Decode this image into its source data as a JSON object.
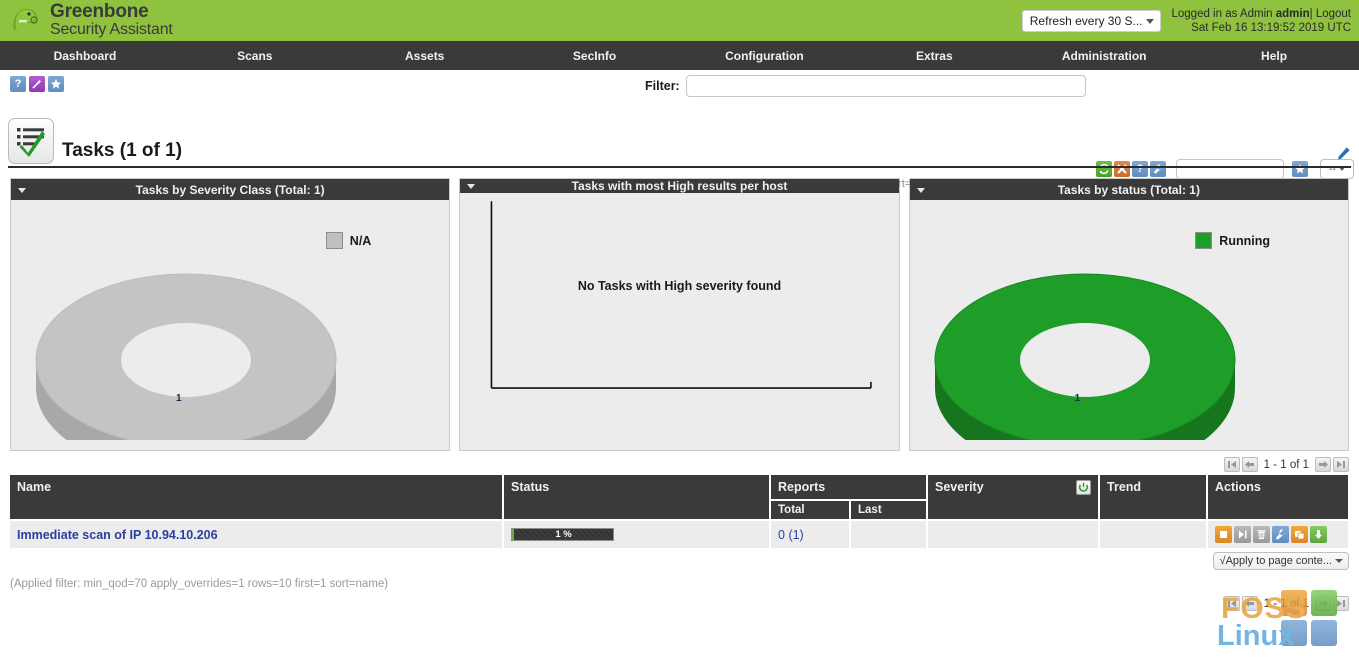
{
  "header": {
    "brand_line1": "Greenbone",
    "brand_line2": "Security Assistant",
    "refresh_select": "Refresh every 30 S...",
    "logged_in_prefix": "Logged in as",
    "role": "Admin",
    "username": "admin",
    "separator": "|",
    "logout": "Logout",
    "datetime": "Sat Feb 16 13:19:52 2019 UTC",
    "brand_bg": "#8fc23f"
  },
  "nav": {
    "items": [
      {
        "label": "Dashboard"
      },
      {
        "label": "Scans"
      },
      {
        "label": "Assets"
      },
      {
        "label": "SecInfo"
      },
      {
        "label": "Configuration"
      },
      {
        "label": "Extras"
      },
      {
        "label": "Administration"
      },
      {
        "label": "Help"
      }
    ]
  },
  "toolbar": {
    "icons": [
      {
        "name": "help-icon",
        "glyph": "?"
      },
      {
        "name": "wizard-icon",
        "glyph": "✳"
      },
      {
        "name": "favorites-star-icon",
        "glyph": "★"
      }
    ],
    "filter_label": "Filter:",
    "filter_value": "",
    "filter_placeholder": "",
    "filter_applied_text": "min_qod=70 apply_overrides=1 rows=10 first=1 sort=name",
    "action_icons": [
      {
        "name": "refresh-filter-icon",
        "glyph": "↻"
      },
      {
        "name": "reset-filter-icon",
        "glyph": "✖"
      },
      {
        "name": "filter-help-icon",
        "glyph": "?"
      },
      {
        "name": "edit-filter-icon",
        "glyph": "⚒"
      }
    ],
    "filter_name_value": "",
    "filter_name_placeholder": "",
    "save-star": "★",
    "mini_select_value": "--"
  },
  "page": {
    "title": "Tasks (1 of 1)",
    "edit_icon": "edit-dashboard-icon"
  },
  "dashboard": {
    "panels": [
      {
        "title": "Tasks by Severity Class (Total: 1)",
        "legend": [
          {
            "label": "N/A",
            "color": "#c0c0c0"
          }
        ],
        "center_value": "1"
      },
      {
        "title": "Tasks with most High results per host",
        "empty_message": "No Tasks with High severity found"
      },
      {
        "title": "Tasks by status (Total: 1)",
        "legend": [
          {
            "label": "Running",
            "color": "#1e9e29"
          }
        ],
        "center_value": "1"
      }
    ]
  },
  "chart_data": [
    {
      "type": "pie",
      "title": "Tasks by Severity Class (Total: 1)",
      "labels": [
        "N/A"
      ],
      "values": [
        1
      ],
      "colors": [
        "#c0c0c0"
      ],
      "total": 1,
      "legend_position": "top-right",
      "center_label": "1"
    },
    {
      "type": "bar",
      "title": "Tasks with most High results per host",
      "categories": [],
      "values": [],
      "xlabel": "",
      "ylabel": "",
      "grid": false,
      "annotation": "No Tasks with High severity found"
    },
    {
      "type": "pie",
      "title": "Tasks by status (Total: 1)",
      "labels": [
        "Running"
      ],
      "values": [
        1
      ],
      "colors": [
        "#1e9e29"
      ],
      "total": 1,
      "legend_position": "top-right",
      "center_label": "1"
    }
  ],
  "pager": {
    "text": "1 - 1 of 1",
    "first": "first-page",
    "prev": "previous-page",
    "next": "next-page",
    "last": "last-page"
  },
  "table": {
    "columns": {
      "name": "Name",
      "status": "Status",
      "reports": "Reports",
      "reports_total": "Total",
      "reports_last": "Last",
      "severity": "Severity",
      "trend": "Trend",
      "actions": "Actions"
    },
    "rows": [
      {
        "name": "Immediate scan of IP 10.94.10.206",
        "status_percent": "1 %",
        "reports_total": "0",
        "reports_total_paren": "(1)",
        "reports_last": "",
        "severity": "",
        "trend": "",
        "actions": [
          {
            "name": "stop-task-icon",
            "glyph": "■"
          },
          {
            "name": "resume-task-icon",
            "glyph": "▶"
          },
          {
            "name": "delete-task-icon",
            "glyph": "🗑"
          },
          {
            "name": "edit-task-icon",
            "glyph": "⚒"
          },
          {
            "name": "clone-task-icon",
            "glyph": "❐"
          },
          {
            "name": "export-task-icon",
            "glyph": "⬇"
          }
        ]
      }
    ]
  },
  "bottom": {
    "apply_select": "√Apply to page conte...",
    "applied_filter_note": "(Applied filter: min_qod=70 apply_overrides=1 rows=10 first=1 sort=name)"
  },
  "watermark": {
    "line1": "FOSS",
    "line2": "Linux"
  }
}
